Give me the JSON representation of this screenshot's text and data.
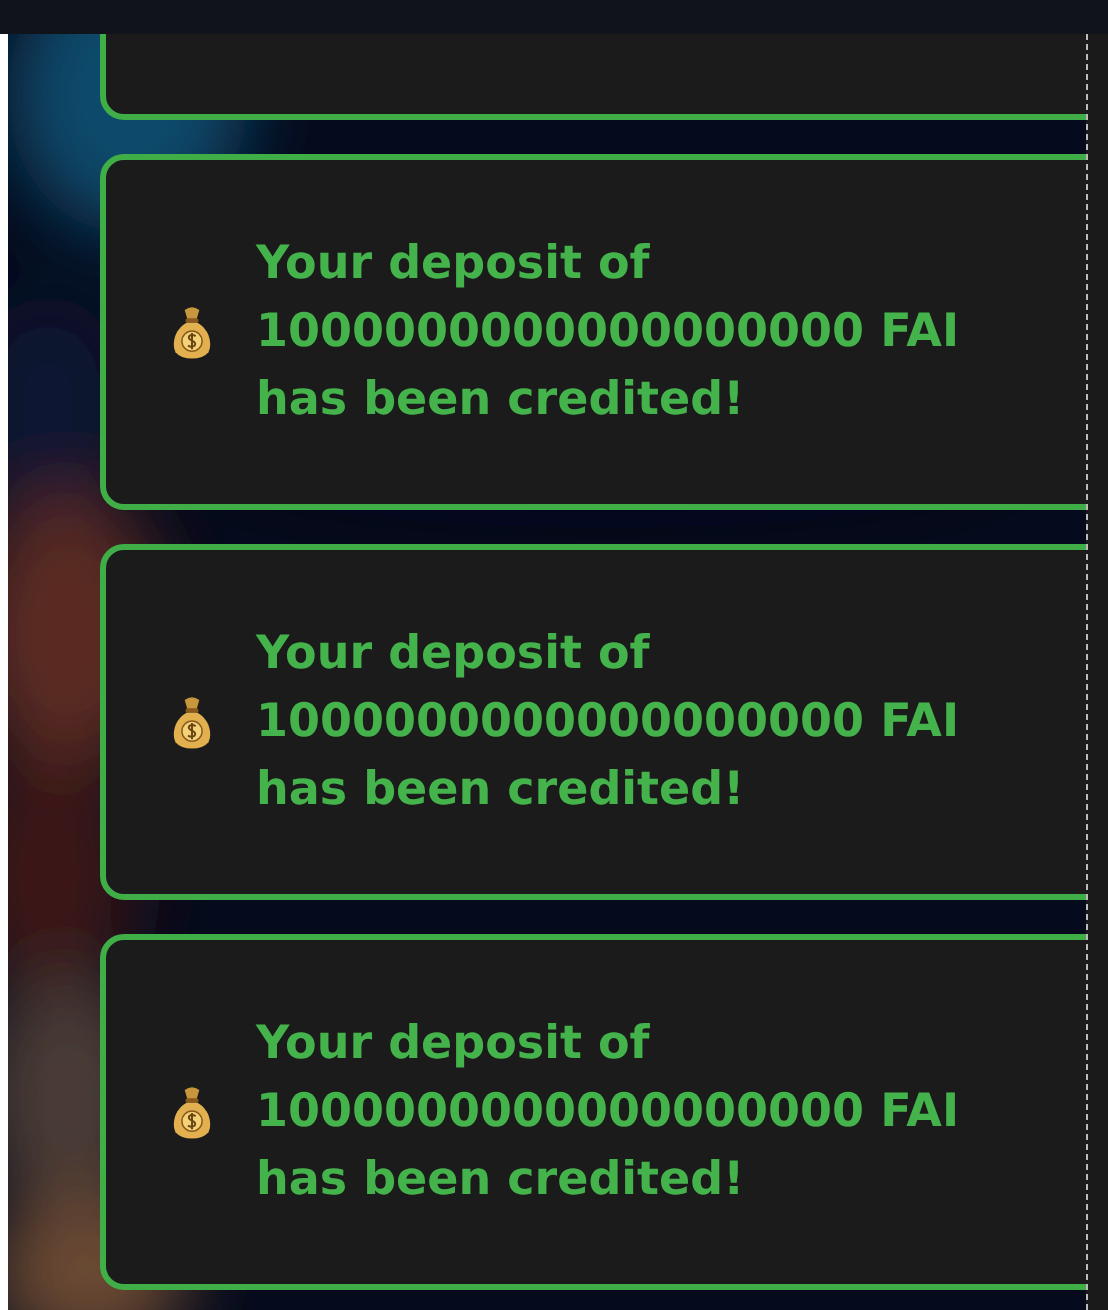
{
  "notifications": [
    {
      "lines": [
        "Your deposit of",
        "1000000000000000000 FAI",
        "has been credited!"
      ]
    },
    {
      "lines": [
        "Your deposit of",
        "1000000000000000000 FAI",
        "has been credited!"
      ]
    },
    {
      "lines": [
        "Your deposit of",
        "1000000000000000000 FAI",
        "has been credited!"
      ]
    }
  ]
}
